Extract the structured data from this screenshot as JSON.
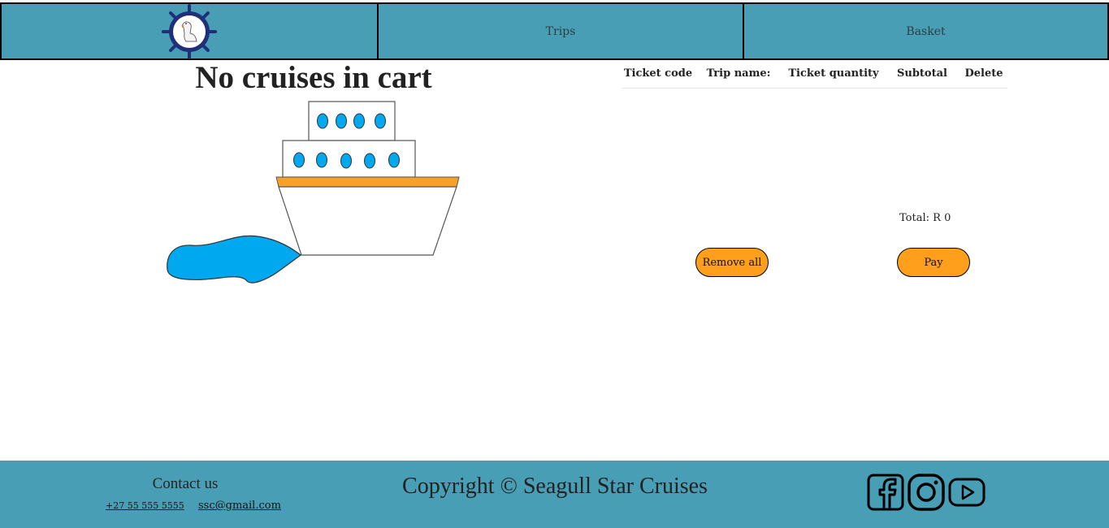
{
  "nav": {
    "logo_icon": "seagull-ship-wheel-logo",
    "trips_label": "Trips",
    "basket_label": "Basket"
  },
  "cart": {
    "empty_message": "No cruises in cart",
    "illustration_icon": "cruise-ship-illustration",
    "columns": [
      "Ticket code",
      "Trip name:",
      "Ticket quantity",
      "Subtotal",
      "Delete"
    ],
    "rows": [],
    "total_label": "Total: R",
    "total_value": "0",
    "remove_all_label": "Remove all",
    "pay_label": "Pay"
  },
  "footer": {
    "contact_title": "Contact us",
    "phone": "+27 55 555 5555",
    "email": "ssc@gmail.com",
    "copyright": "Copyright © Seagull Star Cruises",
    "socials": [
      "facebook-icon",
      "instagram-icon",
      "youtube-icon"
    ]
  },
  "colors": {
    "nav_bg": "#489fb5",
    "button_bg": "#ff9f1c",
    "ship_accent": "#f7a128",
    "water": "#00a8f0"
  }
}
